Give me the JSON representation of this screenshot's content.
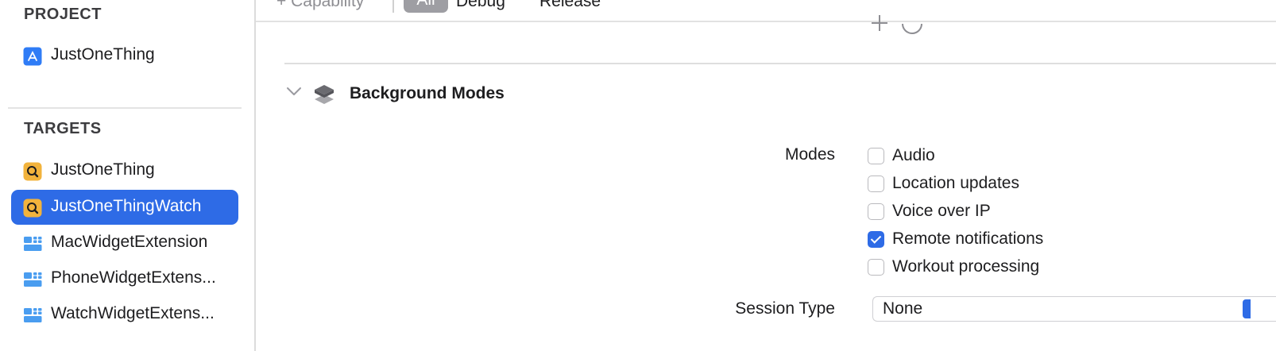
{
  "sidebar": {
    "project_title": "PROJECT",
    "project_items": [
      {
        "label": "JustOneThing",
        "icon": "app-store-icon"
      }
    ],
    "targets_title": "TARGETS",
    "target_items": [
      {
        "label": "JustOneThing",
        "icon": "magnifier-app-icon",
        "selected": false
      },
      {
        "label": "JustOneThingWatch",
        "icon": "magnifier-app-icon",
        "selected": true
      },
      {
        "label": "MacWidgetExtension",
        "icon": "widget-extension-icon",
        "selected": false
      },
      {
        "label": "PhoneWidgetExtens...",
        "icon": "widget-extension-icon",
        "selected": false
      },
      {
        "label": "WatchWidgetExtens...",
        "icon": "widget-extension-icon",
        "selected": false
      }
    ]
  },
  "toolbar": {
    "capability_label": "+ Capability",
    "filters": [
      "All",
      "Debug",
      "Release"
    ],
    "selected_filter": "All"
  },
  "capability": {
    "title": "Background Modes",
    "modes_label": "Modes",
    "modes": [
      {
        "label": "Audio",
        "checked": false
      },
      {
        "label": "Location updates",
        "checked": false
      },
      {
        "label": "Voice over IP",
        "checked": false
      },
      {
        "label": "Remote notifications",
        "checked": true
      },
      {
        "label": "Workout processing",
        "checked": false
      }
    ],
    "session_type_label": "Session Type",
    "session_type_value": "None"
  },
  "colors": {
    "accent": "#2e6be6",
    "selected_filter_bg": "#9e9ea3",
    "target_icon_bg": "#f2b33c",
    "widget_icon": "#4a9df0"
  }
}
